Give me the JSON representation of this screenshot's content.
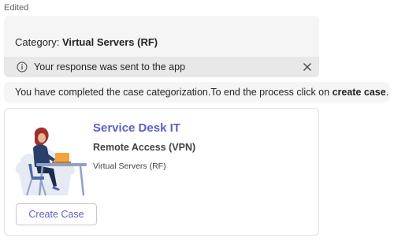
{
  "header": {
    "edited_label": "Edited"
  },
  "category_card": {
    "label": "Category:",
    "value": "Virtual Servers (RF)",
    "notice": {
      "icon": "info-icon",
      "text": "Your response was sent to the app",
      "close_icon": "close-icon"
    }
  },
  "completion_message": {
    "text_before": "You have completed the case categorization.To end the process click on ",
    "emphasis": "create case",
    "text_after": "."
  },
  "service_card": {
    "illustration": "person-at-laptop-illustration",
    "title": "Service Desk IT",
    "subtitle": "Remote Access (VPN)",
    "detail": "Virtual Servers (RF)",
    "button_label": "Create Case"
  },
  "colors": {
    "accent": "#5b5fc7",
    "card_bg": "#f5f5f5",
    "notice_bg": "#e8e8e8",
    "text": "#242424"
  }
}
